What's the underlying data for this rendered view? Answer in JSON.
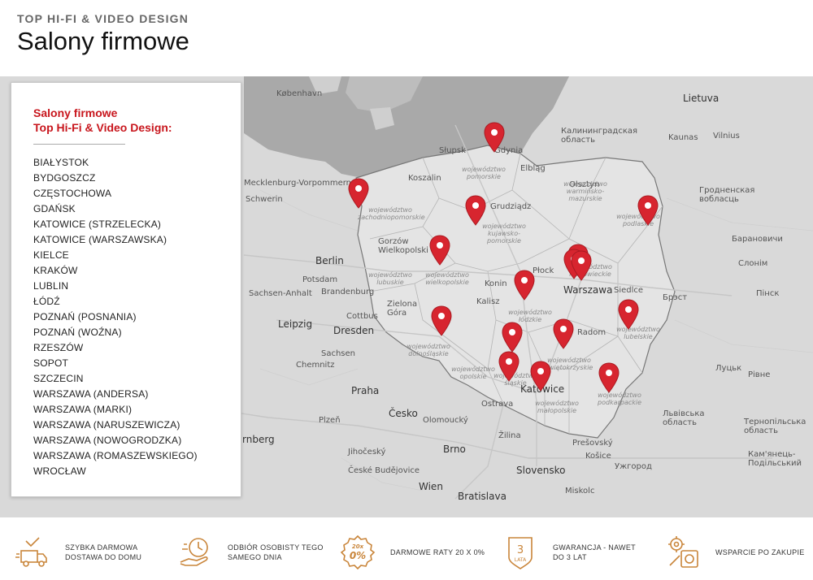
{
  "header": {
    "eyebrow": "TOP HI-FI & VIDEO DESIGN",
    "title": "Salony firmowe"
  },
  "panel": {
    "title_line1": "Salony firmowe",
    "title_line2": "Top Hi-Fi & Video Design:",
    "stores": [
      "BIAŁYSTOK",
      "BYDGOSZCZ",
      "CZĘSTOCHOWA",
      "GDAŃSK",
      "KATOWICE (STRZELECKA)",
      "KATOWICE (WARSZAWSKA)",
      "KIELCE",
      "KRAKÓW",
      "LUBLIN",
      "ŁÓDŹ",
      "POZNAŃ (POSNANIA)",
      "POZNAŃ (WOŹNA)",
      "RZESZÓW",
      "SOPOT",
      "SZCZECIN",
      "WARSZAWA (ANDERSA)",
      "WARSZAWA (MARKI)",
      "WARSZAWA (NARUSZEWICZA)",
      "WARSZAWA (NOWOGRODZKA)",
      "WARSZAWA (ROMASZEWSKIEGO)",
      "WROCŁAW"
    ]
  },
  "map": {
    "labels": {
      "kobenhavn": "København",
      "mecklenburg": "Mecklenburg-Vorpommern",
      "schwerin": "Schwerin",
      "berlin": "Berlin",
      "potsdam": "Potsdam",
      "brandenburg": "Brandenburg",
      "sachsen_anhalt": "Sachsen-Anhalt",
      "leipzig": "Leipzig",
      "dresden": "Dresden",
      "sachsen": "Sachsen",
      "chemnitz": "Chemnitz",
      "cottbus": "Cottbus",
      "praha": "Praha",
      "cesko": "Česko",
      "plzen": "Plzeň",
      "jihocesky": "Jihočeský",
      "ceske_budejovice": "České Budějovice",
      "nurnberg": "rnberg",
      "brno": "Brno",
      "wien": "Wien",
      "bratislava": "Bratislava",
      "slovensko": "Slovensko",
      "zilina": "Žilina",
      "kosice": "Košice",
      "presov": "Prešovský",
      "uzhorod": "Ужгород",
      "miskolc": "Miskolc",
      "ostrava": "Ostrava",
      "olomouc": "Olomoucký",
      "slupsk": "Słupsk",
      "gdynia": "Gdynia",
      "elblag": "Elbląg",
      "koszalin": "Koszalin",
      "grudziadz": "Grudziądz",
      "gorzow": "Gorzów Wielkopolski",
      "zielona_gora": "Zielona Góra",
      "konin": "Konin",
      "plock": "Płock",
      "kalisz": "Kalisz",
      "warszawa": "Warszawa",
      "siedlce": "Siedlce",
      "radom": "Radom",
      "katowice": "Katowice",
      "olsztyn": "Olsztyn",
      "kaliningrad": "Калининградская область",
      "kaunas": "Kaunas",
      "vilnius": "Vilnius",
      "lietuva": "Lietuva",
      "grodno": "Гродненская вобласць",
      "baranovichi": "Барановичи",
      "brest": "Брэст",
      "lutsk": "Луцьк",
      "rivne": "Рівне",
      "lviv": "Львівська область",
      "ternopil": "Тернопільська область",
      "kamyanets": "Кам'янець-Подільський",
      "slonim": "Слонім",
      "pinsk": "Пінск"
    },
    "regions": {
      "pomorskie": "województwo pomorskie",
      "zachodniopomorskie": "województwo zachodniopomorskie",
      "warminsko": "województwo warmińsko-mazurskie",
      "kujawsko": "województwo kujawsko-pomorskie",
      "podlaskie": "województwo podlaskie",
      "lubuskie": "województwo lubuskie",
      "wielkopolskie": "województwo wielkopolskie",
      "lodzkie": "województwo łódzkie",
      "mazowieckie": "województwo mazowieckie",
      "lubelskie": "województwo lubelskie",
      "dolnoslaskie": "województwo dolnośląskie",
      "opolskie": "województwo opolskie",
      "slaskie": "województwo śląskie",
      "swietokrzyskie": "województwo świętokrzyskie",
      "malopolskie": "województwo małopolskie",
      "podkarpackie": "województwo podkarpackie"
    },
    "pin_color": "#d7252f"
  },
  "features": [
    {
      "line1": "SZYBKA DARMOWA",
      "line2": "DOSTAWA DO DOMU"
    },
    {
      "line1": "ODBIÓR OSOBISTY TEGO",
      "line2": "SAMEGO DNIA"
    },
    {
      "line1": "DARMOWE RATY 20 X 0%",
      "line2": ""
    },
    {
      "line1": "GWARANCJA - NAWET",
      "line2": "DO 3 LAT"
    },
    {
      "line1": "WSPARCIE PO ZAKUPIE",
      "line2": ""
    }
  ],
  "feature_icons": {
    "badge_top": "20x",
    "badge_main": "0%",
    "shield_num": "3",
    "shield_text": "LATA"
  },
  "accent_color": "#c8161d",
  "icon_color": "#c9853a"
}
